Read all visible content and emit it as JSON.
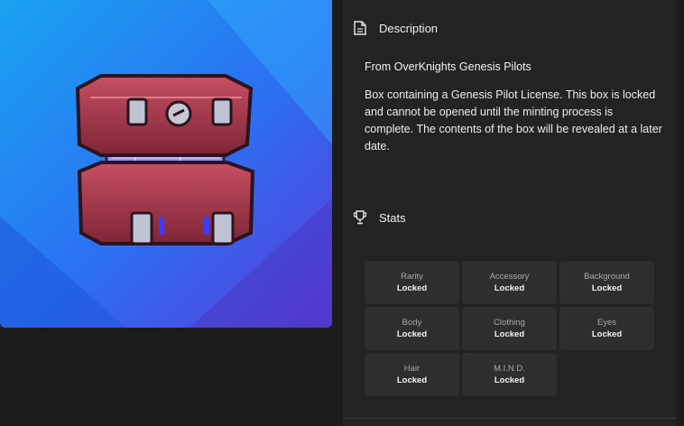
{
  "description": {
    "heading": "Description",
    "source": "From OverKnights Genesis Pilots",
    "body": "Box containing a Genesis Pilot License. This box is locked and cannot be opened until the minting process is complete. The contents of the box will be revealed at a later date."
  },
  "stats": {
    "heading": "Stats",
    "items": [
      {
        "label": "Rarity",
        "value": "Locked"
      },
      {
        "label": "Accessory",
        "value": "Locked"
      },
      {
        "label": "Background",
        "value": "Locked"
      },
      {
        "label": "Body",
        "value": "Locked"
      },
      {
        "label": "Clothing",
        "value": "Locked"
      },
      {
        "label": "Eyes",
        "value": "Locked"
      },
      {
        "label": "Hair",
        "value": "Locked"
      },
      {
        "label": "M.I.N.D.",
        "value": "Locked"
      }
    ]
  },
  "colors": {
    "background": "#1c1c1c",
    "panel": "#232323",
    "stat_tile": "#2e2e2e",
    "art_blue": "#2f7bff",
    "box_red": "#a8344a"
  },
  "icons": [
    "document-icon",
    "trophy-icon"
  ]
}
